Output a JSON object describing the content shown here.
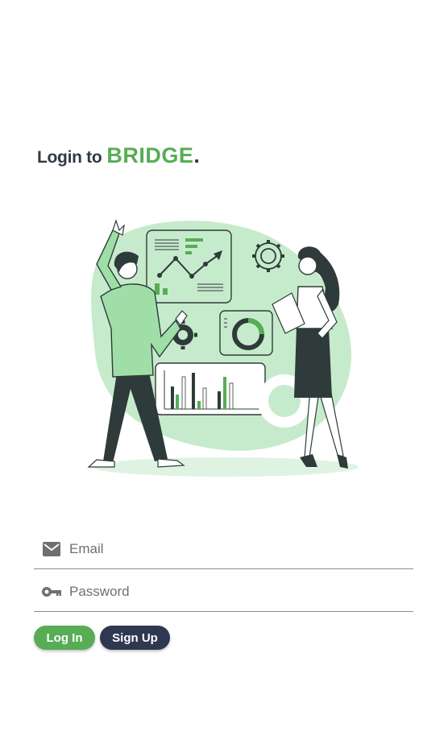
{
  "header": {
    "title_prefix": "Login to",
    "brand": "BRIDGE",
    "brand_suffix": "."
  },
  "form": {
    "email": {
      "placeholder": "Email",
      "value": "",
      "icon": "envelope-icon"
    },
    "password": {
      "placeholder": "Password",
      "value": "",
      "icon": "key-icon"
    }
  },
  "actions": {
    "login_label": "Log In",
    "signup_label": "Sign Up"
  },
  "illustration": {
    "subject": "two people presenting analytics dashboard"
  },
  "colors": {
    "brand_green": "#57ad55",
    "dark_navy": "#2e3850",
    "text_dark": "#2f3946",
    "light_green": "#c6ebcc"
  }
}
